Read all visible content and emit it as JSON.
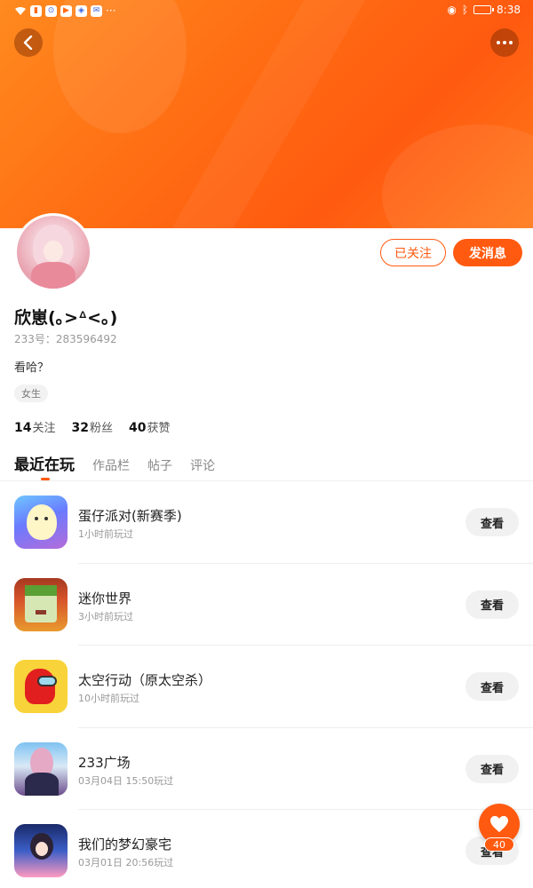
{
  "status_bar": {
    "time": "8:38"
  },
  "profile": {
    "follow_label": "已关注",
    "message_label": "发消息",
    "name": "欣崽(｡>ᐞ<｡)",
    "uid_text": "233号：283596492",
    "bio": "看哈？",
    "gender_tag": "女生",
    "stats": [
      {
        "count": "14",
        "label": "关注"
      },
      {
        "count": "32",
        "label": "粉丝"
      },
      {
        "count": "40",
        "label": "获赞"
      }
    ]
  },
  "tabs": [
    {
      "label": "最近在玩"
    },
    {
      "label": "作品栏"
    },
    {
      "label": "帖子"
    },
    {
      "label": "评论"
    }
  ],
  "games": [
    {
      "title": "蛋仔派对(新赛季)",
      "time": "1小时前玩过",
      "button": "查看",
      "icon": "egg-party-icon"
    },
    {
      "title": "迷你世界",
      "time": "3小时前玩过",
      "button": "查看",
      "icon": "mini-world-icon"
    },
    {
      "title": "太空行动（原太空杀）",
      "time": "10小时前玩过",
      "button": "查看",
      "icon": "space-action-icon"
    },
    {
      "title": "233广场",
      "time": "03月04日 15:50玩过",
      "button": "查看",
      "icon": "plaza-233-icon"
    },
    {
      "title": "我们的梦幻豪宅",
      "time": "03月01日 20:56玩过",
      "button": "查看",
      "icon": "dream-mansion-icon"
    }
  ],
  "like_fab": {
    "count": "40"
  },
  "colors": {
    "accent": "#ff5a10",
    "banner": "#ff7a1a"
  }
}
